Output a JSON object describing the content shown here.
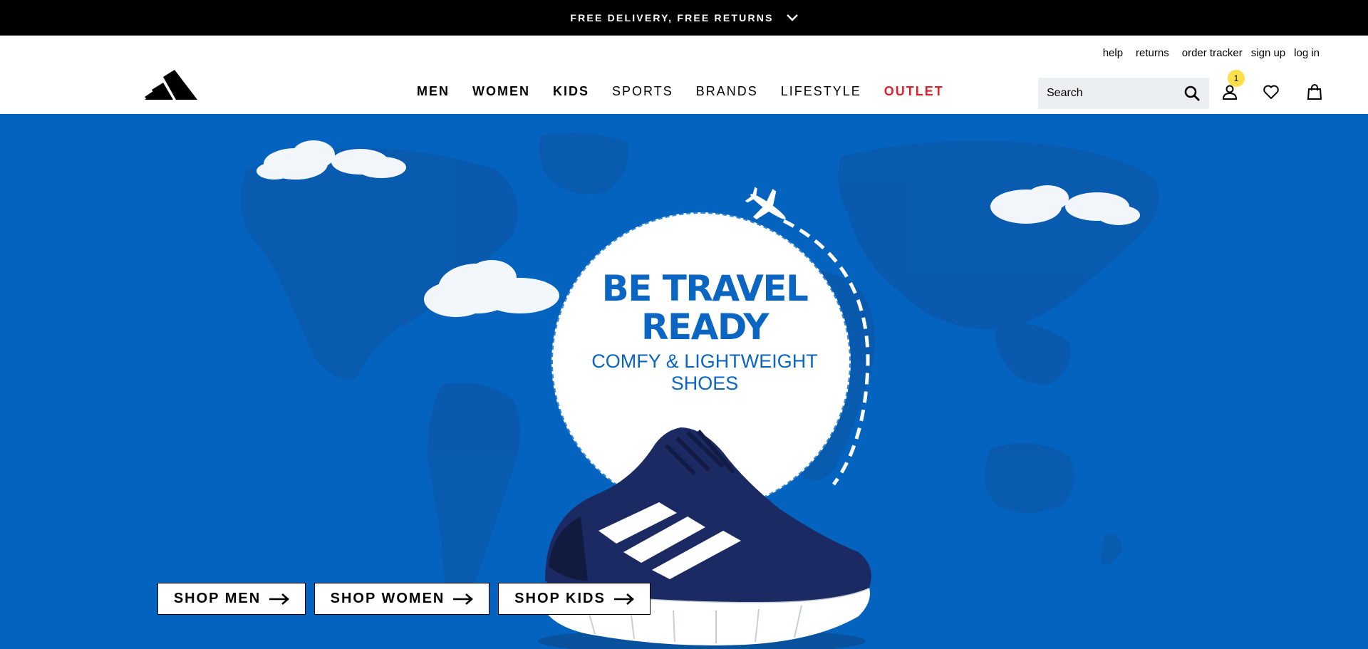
{
  "promo": {
    "text": "FREE DELIVERY, FREE RETURNS"
  },
  "utility_nav": [
    "help",
    "returns",
    "order tracker",
    "sign up",
    "log in"
  ],
  "main_nav": [
    {
      "label": "MEN",
      "style": "bold"
    },
    {
      "label": "WOMEN",
      "style": "bold"
    },
    {
      "label": "KIDS",
      "style": "bold"
    },
    {
      "label": "SPORTS",
      "style": "light"
    },
    {
      "label": "BRANDS",
      "style": "light"
    },
    {
      "label": "LIFESTYLE",
      "style": "light"
    },
    {
      "label": "OUTLET",
      "style": "outlet"
    }
  ],
  "search": {
    "placeholder": "Search"
  },
  "account": {
    "badge_count": "1"
  },
  "hero": {
    "title_line1": "BE TRAVEL",
    "title_line2": "READY",
    "subtitle_line1": "COMFY & LIGHTWEIGHT",
    "subtitle_line2": "SHOES",
    "background_color": "#0463be"
  },
  "shop_buttons": {
    "men": "SHOP MEN",
    "women": "SHOP WOMEN",
    "kids": "SHOP KIDS"
  },
  "colors": {
    "outlet_red": "#e0202b",
    "badge_yellow": "#fde047",
    "hero_blue": "#0463be",
    "title_blue": "#0a66c2"
  },
  "icons": [
    "chevron-down-icon",
    "brand-logo",
    "search-icon",
    "account-icon",
    "heart-icon",
    "bag-icon",
    "airplane-icon",
    "arrow-right-icon"
  ]
}
